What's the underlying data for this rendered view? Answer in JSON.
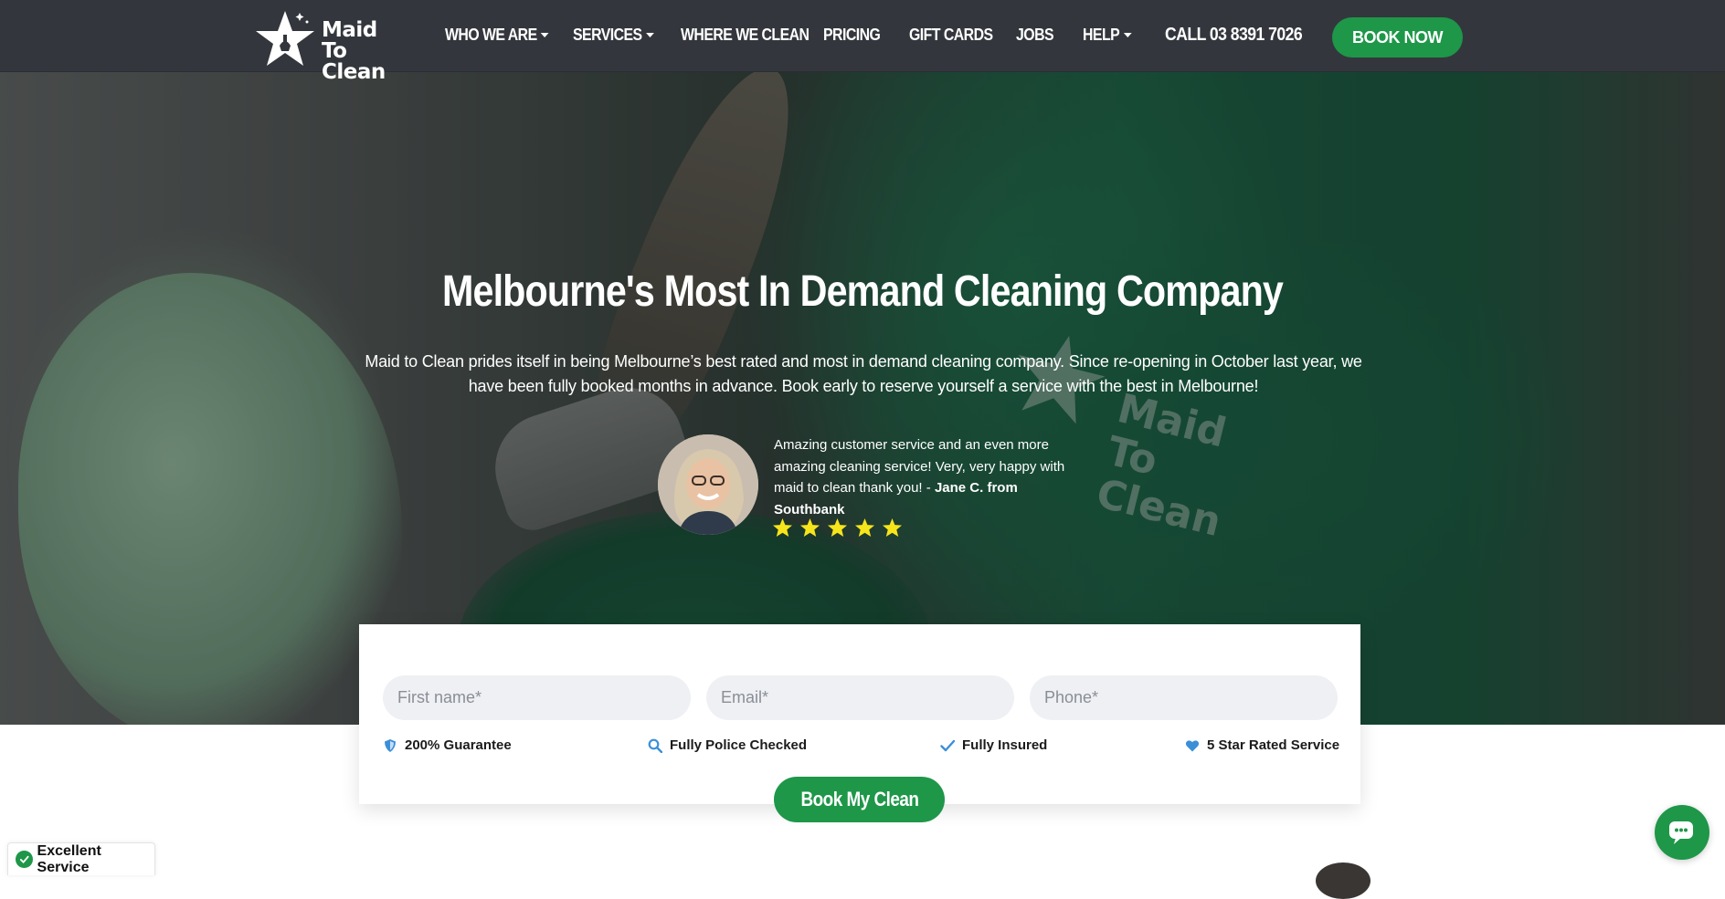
{
  "nav": {
    "logo_line1": "Maid",
    "logo_line2": "To Clean",
    "items": [
      {
        "label": "WHO WE ARE",
        "dropdown": true
      },
      {
        "label": "SERVICES",
        "dropdown": true
      },
      {
        "label": "WHERE WE CLEAN",
        "dropdown": false
      },
      {
        "label": "PRICING",
        "dropdown": false
      },
      {
        "label": "GIFT CARDS",
        "dropdown": false
      },
      {
        "label": "JOBS",
        "dropdown": false
      },
      {
        "label": "HELP",
        "dropdown": true
      }
    ],
    "phone": "CALL 03 8391 7026",
    "book_now": "BOOK NOW"
  },
  "hero": {
    "title": "Melbourne's Most In Demand Cleaning Company",
    "subtitle": "Maid to Clean prides itself in being Melbourne’s best rated and most in demand cleaning company. Since re-opening in October last year, we have been fully booked months in advance. Book early to reserve yourself a service with the best in Melbourne!",
    "shirt_logo_line1": "Maid",
    "shirt_logo_line2": "To Clean",
    "testimonial": {
      "quote": "Amazing customer service and an even more amazing cleaning service! Very, very happy with maid to clean thank you! -",
      "author": "Jane C. from Southbank",
      "rating": 5
    }
  },
  "form": {
    "first_name_placeholder": "First name*",
    "email_placeholder": "Email*",
    "phone_placeholder": "Phone*",
    "badges": [
      {
        "icon": "shield-icon",
        "label": "200% Guarantee"
      },
      {
        "icon": "search-icon",
        "label": "Fully Police Checked"
      },
      {
        "icon": "check-icon",
        "label": "Fully Insured"
      },
      {
        "icon": "heart-icon",
        "label": "5 Star Rated Service"
      }
    ],
    "submit": "Book My Clean"
  },
  "widgets": {
    "review_badge": "Excellent Service",
    "chat_icon": "chat-icon"
  },
  "colors": {
    "nav_bg": "#33373d",
    "brand_green": "#1e9748",
    "star_yellow": "#f7e51b",
    "badge_icon_blue": "#3b8fd9",
    "field_bg": "#eef0f4"
  }
}
